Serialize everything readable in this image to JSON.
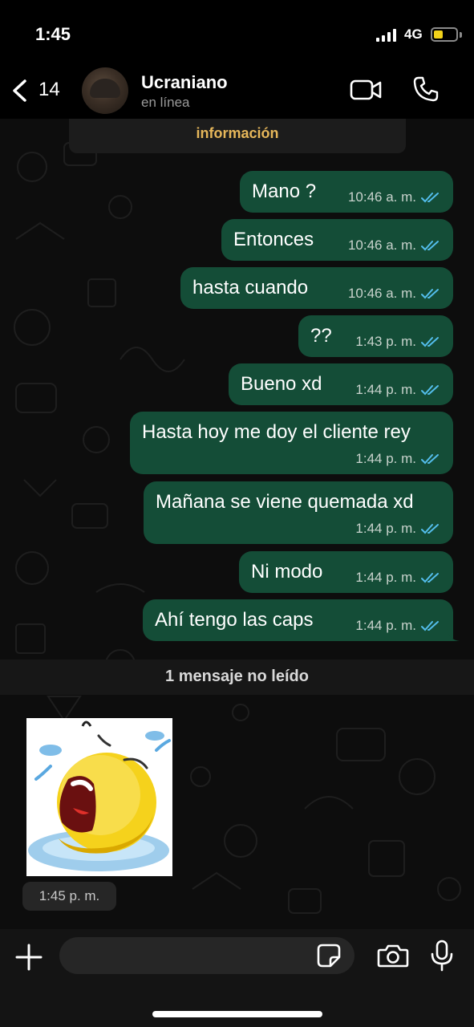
{
  "status_bar": {
    "time": "1:45",
    "network": "4G"
  },
  "header": {
    "back_count": "14",
    "contact_name": "Ucraniano",
    "contact_status": "en línea"
  },
  "info_banner": {
    "text": "información"
  },
  "messages": [
    {
      "text": "Mano ?",
      "time": "10:46 a. m."
    },
    {
      "text": "Entonces",
      "time": "10:46 a. m."
    },
    {
      "text": "hasta cuando",
      "time": "10:46 a. m."
    },
    {
      "text": "??",
      "time": "1:43 p. m."
    },
    {
      "text": "Bueno xd",
      "time": "1:44 p. m."
    },
    {
      "text": "Hasta hoy me doy el cliente rey",
      "time": "1:44 p. m."
    },
    {
      "text": "Mañana se viene quemada xd",
      "time": "1:44 p. m."
    },
    {
      "text": "Ni modo",
      "time": "1:44 p. m."
    },
    {
      "text": "Ahí tengo las caps",
      "time": "1:44 p. m."
    }
  ],
  "unread_banner": "1 mensaje no leído",
  "sticker": {
    "time": "1:45 p. m.",
    "icon": "crying-emoji-sticker"
  },
  "input": {
    "placeholder": ""
  },
  "colors": {
    "outgoing_bubble": "#144d37",
    "read_ticks": "#53bdeb",
    "info_accent": "#e7b75a",
    "battery": "#f2d21a"
  }
}
